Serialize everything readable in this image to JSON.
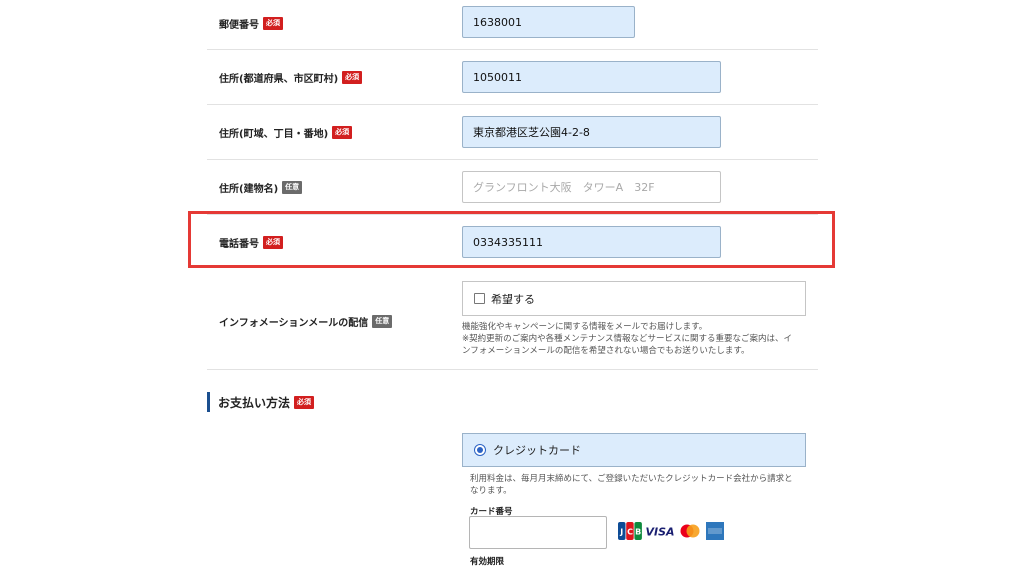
{
  "form": {
    "postal": {
      "label": "郵便番号",
      "badge": "必須",
      "value": "1638001"
    },
    "address_pref": {
      "label": "住所(都道府県、市区町村)",
      "badge": "必須",
      "value": "1050011"
    },
    "address_town": {
      "label": "住所(町域、丁目・番地)",
      "badge": "必須",
      "value": "東京都港区芝公園4-2-8"
    },
    "address_building": {
      "label": "住所(建物名)",
      "badge": "任意",
      "placeholder": "グランフロント大阪　タワーA　32F"
    },
    "phone": {
      "label": "電話番号",
      "badge": "必須",
      "value": "0334335111"
    },
    "newsletter": {
      "label": "インフォメーションメールの配信",
      "badge": "任意",
      "checkbox_label": "希望する",
      "checked": false,
      "note_lines": [
        "機能強化やキャンペーンに関する情報をメールでお届けします。",
        "※契約更新のご案内や各種メンテナンス情報などサービスに関する重要なご案内は、イ",
        "ンフォメーションメールの配信を希望されない場合でもお送りいたします。"
      ]
    }
  },
  "payment": {
    "title": "お支払い方法",
    "badge": "必須",
    "option_label": "クレジットカード",
    "note_lines": [
      "利用料金は、毎月月末締めにて、ご登録いただいたクレジットカード会社から請求と",
      "なります。"
    ],
    "card_number_label": "カード番号",
    "card_number_value": "",
    "next_label": "有効期限",
    "brands": [
      "JCB",
      "VISA",
      "Mastercard",
      "AMEX"
    ]
  },
  "colors": {
    "required": "#d21f1f",
    "optional": "#6b6b6b",
    "highlight": "#e53935",
    "field_bg": "#dcecfc",
    "accent": "#1b4f8f"
  }
}
